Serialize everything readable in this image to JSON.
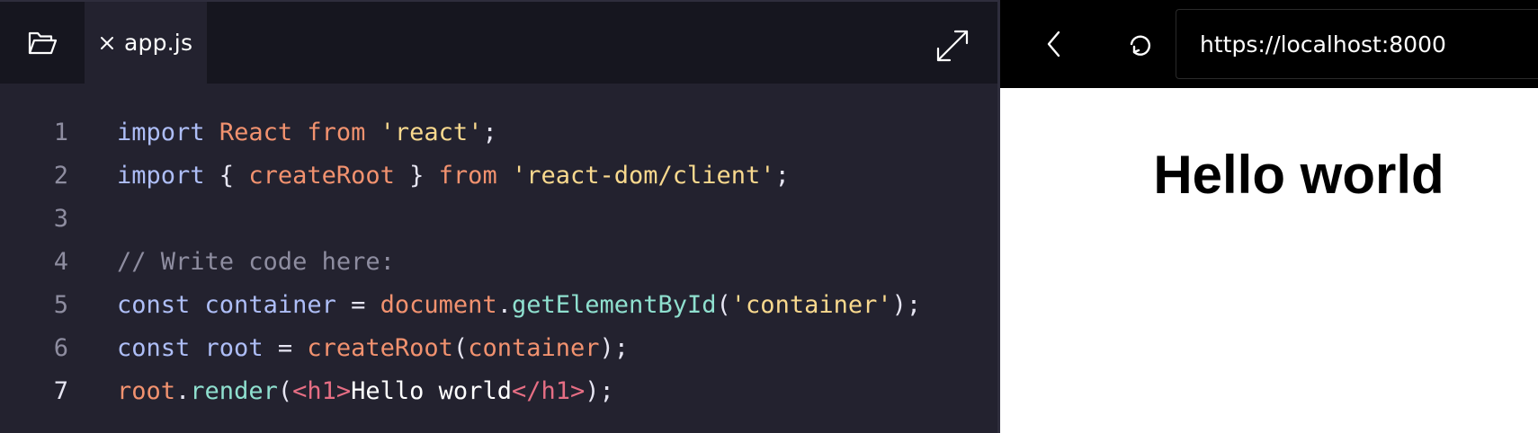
{
  "editor": {
    "tab": {
      "label": "app.js"
    },
    "icons": {
      "folder": "folder-open-icon",
      "tab_close": "close-icon",
      "expand": "expand-icon"
    },
    "lines": [
      {
        "number": "1",
        "tokens": [
          {
            "text": "import",
            "type": "kw"
          },
          {
            "text": " ",
            "type": "punc"
          },
          {
            "text": "React",
            "type": "def"
          },
          {
            "text": " ",
            "type": "punc"
          },
          {
            "text": "from",
            "type": "def"
          },
          {
            "text": " ",
            "type": "punc"
          },
          {
            "text": "'react'",
            "type": "str"
          },
          {
            "text": ";",
            "type": "punc"
          }
        ]
      },
      {
        "number": "2",
        "tokens": [
          {
            "text": "import",
            "type": "kw"
          },
          {
            "text": " { ",
            "type": "punc"
          },
          {
            "text": "createRoot",
            "type": "def"
          },
          {
            "text": " } ",
            "type": "punc"
          },
          {
            "text": "from",
            "type": "def"
          },
          {
            "text": " ",
            "type": "punc"
          },
          {
            "text": "'react-dom/client'",
            "type": "str"
          },
          {
            "text": ";",
            "type": "punc"
          }
        ]
      },
      {
        "number": "3",
        "tokens": []
      },
      {
        "number": "4",
        "tokens": [
          {
            "text": "// Write code here:",
            "type": "cmt"
          }
        ]
      },
      {
        "number": "5",
        "tokens": [
          {
            "text": "const",
            "type": "kw"
          },
          {
            "text": " ",
            "type": "punc"
          },
          {
            "text": "container",
            "type": "var"
          },
          {
            "text": " = ",
            "type": "punc"
          },
          {
            "text": "document",
            "type": "def"
          },
          {
            "text": ".",
            "type": "punc"
          },
          {
            "text": "getElementById",
            "type": "fn"
          },
          {
            "text": "(",
            "type": "punc"
          },
          {
            "text": "'container'",
            "type": "str"
          },
          {
            "text": ");",
            "type": "punc"
          }
        ]
      },
      {
        "number": "6",
        "tokens": [
          {
            "text": "const",
            "type": "kw"
          },
          {
            "text": " ",
            "type": "punc"
          },
          {
            "text": "root",
            "type": "var"
          },
          {
            "text": " = ",
            "type": "punc"
          },
          {
            "text": "createRoot",
            "type": "def"
          },
          {
            "text": "(",
            "type": "punc"
          },
          {
            "text": "container",
            "type": "def"
          },
          {
            "text": ");",
            "type": "punc"
          }
        ]
      },
      {
        "number": "7",
        "active": true,
        "tokens": [
          {
            "text": "root",
            "type": "def"
          },
          {
            "text": ".",
            "type": "punc"
          },
          {
            "text": "render",
            "type": "fn"
          },
          {
            "text": "(",
            "type": "punc"
          },
          {
            "text": "<h1>",
            "type": "tag"
          },
          {
            "text": "Hello world",
            "type": "text"
          },
          {
            "text": "</h1>",
            "type": "tag"
          },
          {
            "text": ");",
            "type": "punc"
          }
        ]
      }
    ]
  },
  "browser": {
    "url": "https://localhost:8000",
    "icons": {
      "back": "chevron-left-icon",
      "reload": "reload-icon"
    },
    "preview": {
      "heading": "Hello world"
    }
  },
  "colors": {
    "editor_background": "#23222f",
    "toolbar_background": "#16161f",
    "keyword": "#aebef7",
    "definition": "#f2926f",
    "string": "#f9d98e",
    "comment": "#8e8da0",
    "function": "#8fe0cf",
    "tag": "#e66e84",
    "browser_bar": "#000000",
    "preview_background": "#ffffff"
  }
}
